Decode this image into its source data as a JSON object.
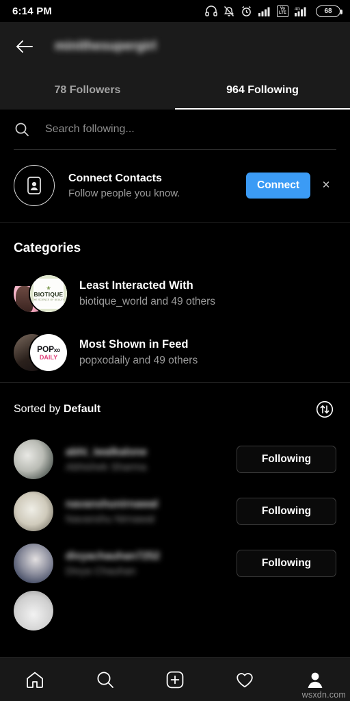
{
  "status_bar": {
    "time": "6:14 PM",
    "battery_level": "68",
    "icons": [
      "headphones-icon",
      "bell-off-icon",
      "alarm-icon",
      "signal-bars-icon",
      "volte-icon",
      "signal-4g-icon",
      "battery-icon"
    ],
    "volte_top": "Vo",
    "volte_bottom": "LTE",
    "network_label": "4G"
  },
  "header": {
    "back_icon": "back-arrow-icon",
    "username": "minithesupergirl",
    "tabs": [
      {
        "label": "78 Followers",
        "active": false
      },
      {
        "label": "964 Following",
        "active": true
      }
    ]
  },
  "search": {
    "icon": "search-icon",
    "placeholder": "Search following...",
    "value": ""
  },
  "connect_contacts": {
    "icon": "contact-card-icon",
    "title": "Connect Contacts",
    "subtitle": "Follow people you know.",
    "button_label": "Connect",
    "button_color": "#3b9bf5",
    "dismiss_icon": "close-icon",
    "dismiss_label": "×"
  },
  "categories": {
    "title": "Categories",
    "items": [
      {
        "title": "Least Interacted With",
        "subtitle": "biotique_world and 49 others",
        "avatar_front_label": "BIOTIQUE",
        "avatar_front_tagline": "THE SCIENCE OF BEAUTY",
        "avatar_front_mark": "❀"
      },
      {
        "title": "Most Shown in Feed",
        "subtitle": "popxodaily and 49 others",
        "avatar_front_label": "POP",
        "avatar_front_label_small": "xo",
        "avatar_front_sub": "DAILY"
      }
    ]
  },
  "sort": {
    "prefix": "Sorted by ",
    "value": "Default",
    "icon": "sort-arrows-icon"
  },
  "users": [
    {
      "handle": "abhi_iwalkalone",
      "name": "Abhishek Sharma",
      "button_label": "Following"
    },
    {
      "handle": "navanshunirnawal",
      "name": "Navanshu Nirnawal",
      "button_label": "Following"
    },
    {
      "handle": "divyachauhan7252",
      "name": "Divya Chauhan",
      "button_label": "Following"
    }
  ],
  "bottom_nav": [
    {
      "icon": "home-icon",
      "active": false
    },
    {
      "icon": "search-icon",
      "active": false
    },
    {
      "icon": "add-post-icon",
      "active": false
    },
    {
      "icon": "heart-icon",
      "active": false
    },
    {
      "icon": "profile-icon",
      "active": true
    }
  ],
  "watermark": "wsxdn.com"
}
